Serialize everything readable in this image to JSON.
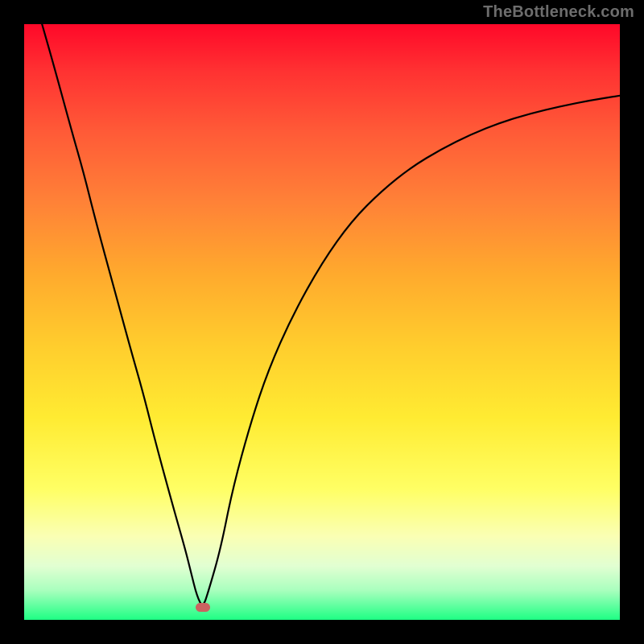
{
  "watermark": "TheBottleneck.com",
  "colors": {
    "background": "#000000",
    "curve": "#000000",
    "marker": "#cb6260",
    "gradient_top": "#ff0829",
    "gradient_bottom": "#1eff84"
  },
  "chart_data": {
    "type": "line",
    "title": "",
    "xlabel": "",
    "ylabel": "",
    "xlim": [
      0,
      100
    ],
    "ylim": [
      0,
      100
    ],
    "x": [
      3,
      5,
      8,
      10,
      12,
      15,
      18,
      20,
      22,
      25,
      27,
      28,
      29,
      30,
      31,
      33,
      35,
      38,
      41,
      45,
      50,
      55,
      60,
      65,
      70,
      75,
      80,
      85,
      90,
      95,
      100
    ],
    "values": [
      100,
      93,
      82,
      75,
      67,
      56,
      45,
      38,
      30,
      19,
      12,
      8,
      4,
      2,
      5,
      12,
      22,
      33,
      42,
      51,
      60,
      67,
      72,
      76,
      79,
      81.5,
      83.5,
      85,
      86.2,
      87.2,
      88
    ],
    "marker": {
      "x": 30,
      "y": 2
    }
  }
}
